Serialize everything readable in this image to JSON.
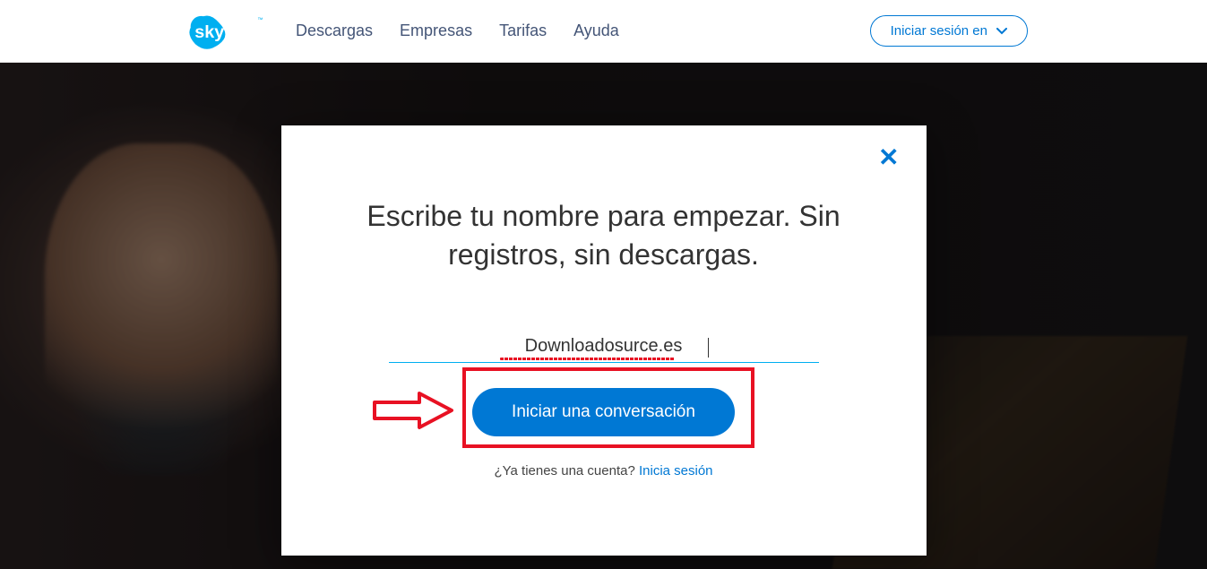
{
  "nav": {
    "items": [
      "Descargas",
      "Empresas",
      "Tarifas",
      "Ayuda"
    ],
    "signin_label": "Iniciar sesión en"
  },
  "modal": {
    "heading": "Escribe tu nombre para empezar. Sin registros, sin descargas.",
    "name_value": "Downloadosurce.es",
    "start_label": "Iniciar una conversación",
    "already_q": "¿Ya tienes una cuenta?",
    "already_link": "Inicia sesión"
  },
  "colors": {
    "skype_blue": "#00aff0",
    "ms_blue": "#0078d4",
    "annotation_red": "#e81123"
  }
}
